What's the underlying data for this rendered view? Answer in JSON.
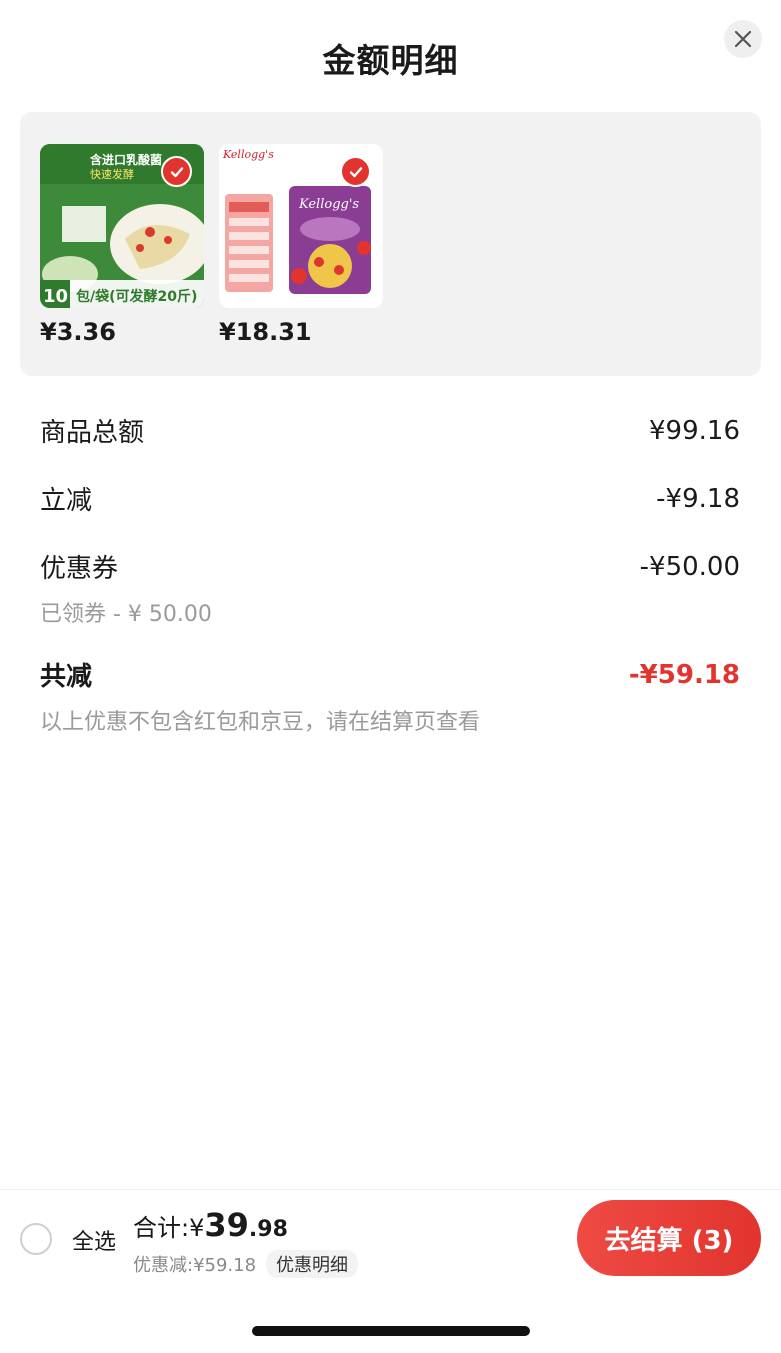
{
  "header": {
    "title": "金额明细"
  },
  "products": [
    {
      "price": "¥3.36",
      "image_icon": "pickled-vegetable-starter-pack-image",
      "checked": true
    },
    {
      "price": "¥18.31",
      "image_icon": "kelloggs-strawberry-cereal-image",
      "checked": true
    }
  ],
  "breakdown": {
    "goods_total": {
      "label": "商品总额",
      "value": "¥99.16"
    },
    "instant_discount": {
      "label": "立减",
      "value": "-¥9.18"
    },
    "coupon": {
      "label": "优惠券",
      "value": "-¥50.00",
      "note": "已领券 - ¥ 50.00"
    },
    "total_discount": {
      "label": "共减",
      "value": "-¥59.18",
      "note": "以上优惠不包含红包和京豆，请在结算页查看"
    }
  },
  "footer": {
    "select_all": "全选",
    "sum_label": "合计:",
    "currency": "¥",
    "sum_integer": "39",
    "sum_decimal": ".98",
    "discount_text": "优惠减:¥59.18",
    "detail_tag": "优惠明细",
    "checkout": "去结算 (3)"
  },
  "colors": {
    "accent": "#e2342e",
    "card_bg": "#f2f2f2"
  }
}
